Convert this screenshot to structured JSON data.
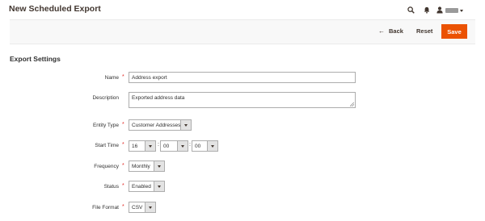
{
  "header": {
    "title": "New Scheduled Export",
    "icons": [
      "search-icon",
      "bell-icon",
      "user-icon",
      "chevron-down-icon"
    ]
  },
  "actions": {
    "back_label": "Back",
    "back_arrow": "←",
    "reset_label": "Reset",
    "save_label": "Save"
  },
  "section": {
    "title": "Export Settings"
  },
  "form": {
    "name": {
      "label": "Name",
      "value": "Address export",
      "required_mark": "*"
    },
    "description": {
      "label": "Description",
      "value": "Exported address data"
    },
    "entity_type": {
      "label": "Entity Type",
      "value": "Customer Addresses",
      "required_mark": "*"
    },
    "start_time": {
      "label": "Start Time",
      "hour": "16",
      "minute": "00",
      "second": "00",
      "separator": ":",
      "required_mark": "*"
    },
    "frequency": {
      "label": "Frequency",
      "value": "Monthly",
      "required_mark": "*"
    },
    "status": {
      "label": "Status",
      "value": "Enabled",
      "required_mark": "*"
    },
    "file_format": {
      "label": "File Format",
      "value": "CSV",
      "required_mark": "*"
    }
  },
  "colors": {
    "accent": "#eb5202",
    "required": "#e02b27",
    "toolbar_bg": "#f8f8f8"
  }
}
